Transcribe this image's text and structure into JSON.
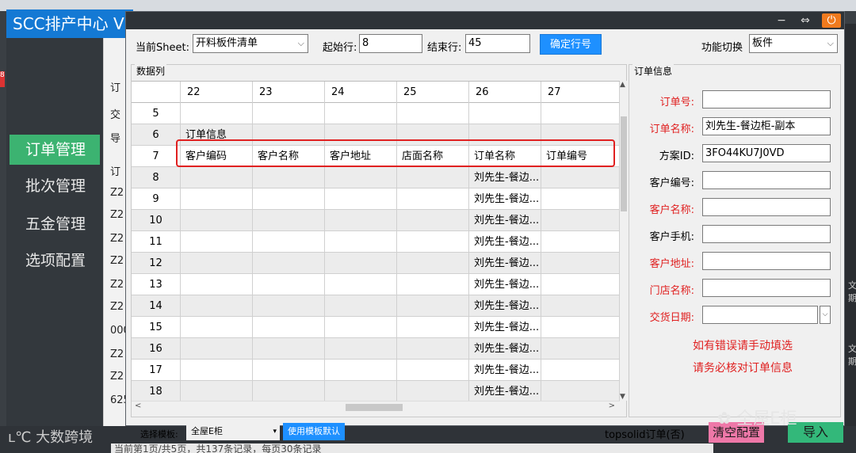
{
  "background_app": {
    "title": "SCC排产中心 V",
    "nav": [
      {
        "label": "订单管理",
        "active": true
      },
      {
        "label": "批次管理",
        "active": false
      },
      {
        "label": "五金管理",
        "active": false
      },
      {
        "label": "选项配置",
        "active": false
      }
    ],
    "panel_cells": [
      "订",
      "交",
      "导",
      "订",
      "Z2",
      "Z2",
      "Z2",
      "Z2",
      "Z2",
      "Z2",
      "000",
      "Z2",
      "Z2",
      "625"
    ],
    "pager_text": "当前第1页/共5页，共137条记录，每页30条记录",
    "right_glyphs": [
      "文",
      "期",
      "文",
      "期"
    ],
    "left_badge": "8"
  },
  "watermarks": {
    "left": "大数跨境",
    "right": "全屋E柜"
  },
  "dialog": {
    "window_buttons": {
      "minimize": "−",
      "restore": "⇔",
      "close": "⏻"
    },
    "toolbar": {
      "sheet_label": "当前Sheet:",
      "sheet_value": "开料板件清单",
      "start_label": "起始行:",
      "start_value": "8",
      "end_label": "结束行:",
      "end_value": "45",
      "confirm_button": "确定行号",
      "func_label": "功能切换",
      "func_value": "板件"
    },
    "data_group": {
      "title": "数据列",
      "column_headers": [
        "22",
        "23",
        "24",
        "25",
        "26",
        "27"
      ],
      "rows": [
        {
          "num": "5",
          "cells": [
            "",
            "",
            "",
            "",
            "",
            ""
          ]
        },
        {
          "num": "6",
          "cells": [
            "订单信息",
            "",
            "",
            "",
            "",
            ""
          ]
        },
        {
          "num": "7",
          "cells": [
            "客户编码",
            "客户名称",
            "客户地址",
            "店面名称",
            "订单名称",
            "订单编号"
          ]
        },
        {
          "num": "8",
          "cells": [
            "",
            "",
            "",
            "",
            "刘先生-餐边...",
            ""
          ]
        },
        {
          "num": "9",
          "cells": [
            "",
            "",
            "",
            "",
            "刘先生-餐边...",
            ""
          ]
        },
        {
          "num": "10",
          "cells": [
            "",
            "",
            "",
            "",
            "刘先生-餐边...",
            ""
          ]
        },
        {
          "num": "11",
          "cells": [
            "",
            "",
            "",
            "",
            "刘先生-餐边...",
            ""
          ]
        },
        {
          "num": "12",
          "cells": [
            "",
            "",
            "",
            "",
            "刘先生-餐边...",
            ""
          ]
        },
        {
          "num": "13",
          "cells": [
            "",
            "",
            "",
            "",
            "刘先生-餐边...",
            ""
          ]
        },
        {
          "num": "14",
          "cells": [
            "",
            "",
            "",
            "",
            "刘先生-餐边...",
            ""
          ]
        },
        {
          "num": "15",
          "cells": [
            "",
            "",
            "",
            "",
            "刘先生-餐边...",
            ""
          ]
        },
        {
          "num": "16",
          "cells": [
            "",
            "",
            "",
            "",
            "刘先生-餐边...",
            ""
          ]
        },
        {
          "num": "17",
          "cells": [
            "",
            "",
            "",
            "",
            "刘先生-餐边...",
            ""
          ]
        },
        {
          "num": "18",
          "cells": [
            "",
            "",
            "",
            "",
            "刘先生-餐边...",
            ""
          ]
        }
      ]
    },
    "order_group": {
      "title": "订单信息",
      "fields": [
        {
          "label": "订单号:",
          "value": "",
          "required": true
        },
        {
          "label": "订单名称:",
          "value": "刘先生-餐边柜-副本",
          "required": true
        },
        {
          "label": "方案ID:",
          "value": "3FO44KU7J0VD",
          "required": false
        },
        {
          "label": "客户编号:",
          "value": "",
          "required": false
        },
        {
          "label": "客户名称:",
          "value": "",
          "required": true
        },
        {
          "label": "客户手机:",
          "value": "",
          "required": false
        },
        {
          "label": "客户地址:",
          "value": "",
          "required": true
        },
        {
          "label": "门店名称:",
          "value": "",
          "required": true
        },
        {
          "label": "交货日期:",
          "value": "",
          "required": true
        }
      ],
      "notes": [
        "如有错误请手动填选",
        "请务必核对订单信息"
      ]
    },
    "footer": {
      "template_label": "选择模板:",
      "template_value": "全屋E柜",
      "use_default_button": "使用模板默认",
      "topsolid_text": "topsolid订单(否)",
      "clear_button": "清空配置",
      "import_button": "导入"
    }
  }
}
